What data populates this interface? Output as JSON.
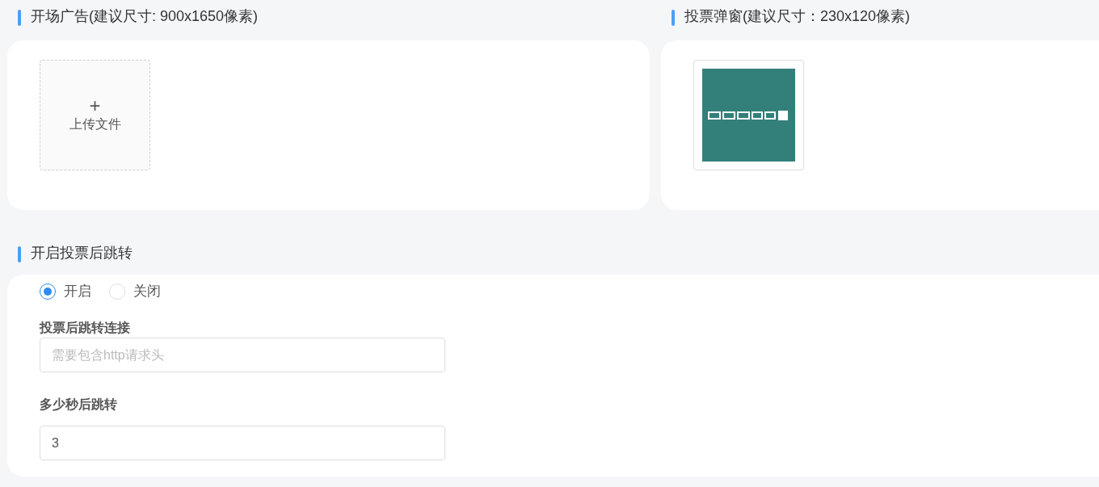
{
  "sections": [
    {
      "title": "开场广告(建议尺寸: 900x1650像素)",
      "upload": {
        "kind": "empty",
        "label": "上传文件",
        "icon": "+"
      }
    },
    {
      "title": "投票弹窗(建议尺寸：230x120像素)"
    }
  ],
  "redirect": {
    "title": "开启投票后跳转",
    "options": [
      {
        "label": "开启",
        "selected": true
      },
      {
        "label": "关闭",
        "selected": false
      }
    ],
    "fields": [
      {
        "label": "投票后跳转连接",
        "placeholder": "需要包含http请求头"
      },
      {
        "label": "多少秒后跳转",
        "value": "3"
      }
    ]
  }
}
